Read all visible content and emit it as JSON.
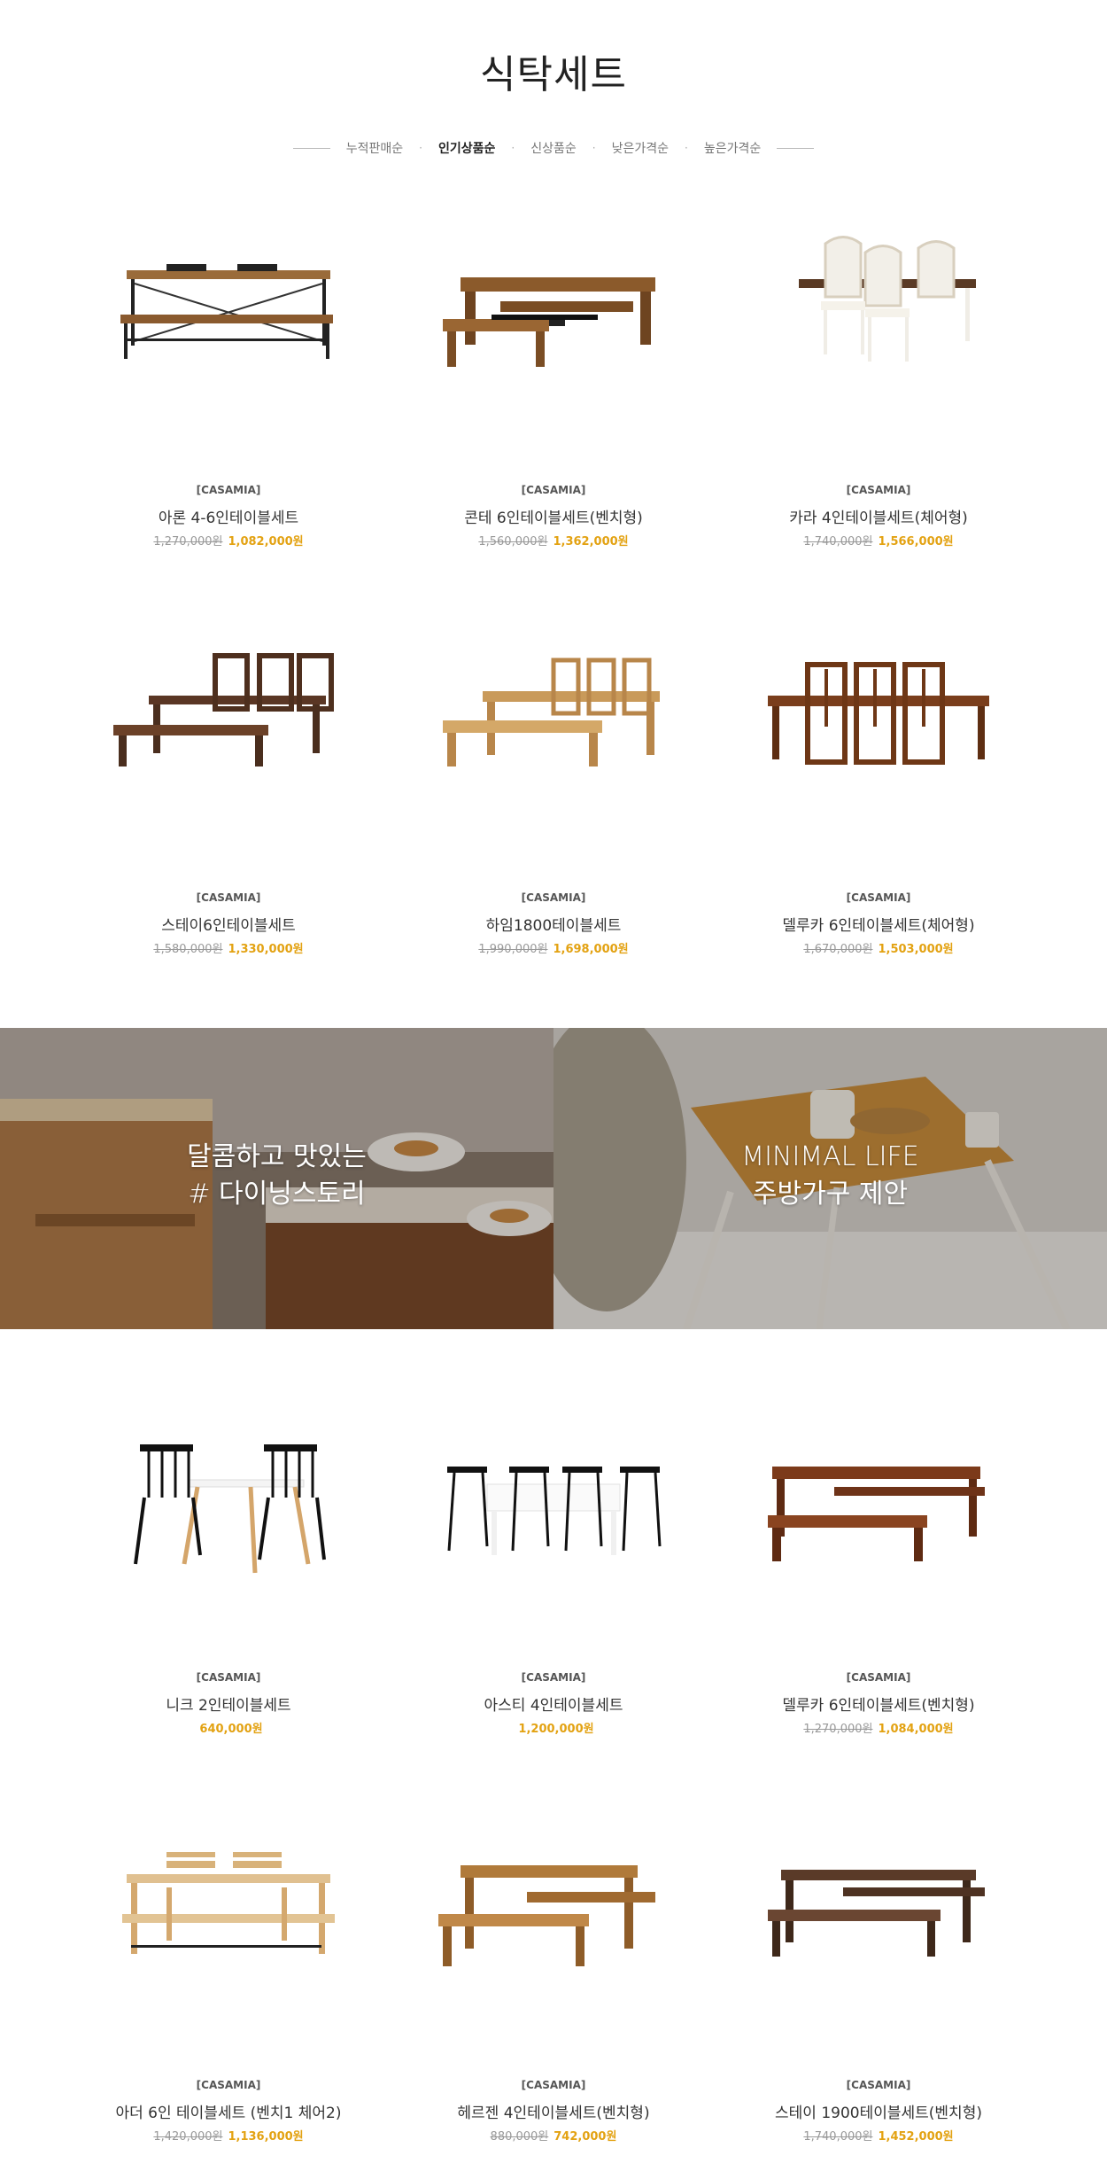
{
  "page": {
    "title": "식탁세트"
  },
  "sort": {
    "options": [
      "누적판매순",
      "인기상품순",
      "신상품순",
      "낮은가격순",
      "높은가격순"
    ],
    "active": "인기상품순"
  },
  "products": [
    {
      "brand": "[CASAMIA]",
      "name": "아론 4-6인테이블세트",
      "old_price": "1,270,000원",
      "price": "1,082,000원",
      "image": "dining-set-bench-black-frame"
    },
    {
      "brand": "[CASAMIA]",
      "name": "콘테 6인테이블세트(벤치형)",
      "old_price": "1,560,000원",
      "price": "1,362,000원",
      "image": "dining-set-wood-benches"
    },
    {
      "brand": "[CASAMIA]",
      "name": "카라 4인테이블세트(체어형)",
      "old_price": "1,740,000원",
      "price": "1,566,000원",
      "image": "dining-set-white-classic-chairs"
    },
    {
      "brand": "[CASAMIA]",
      "name": "스테이6인테이블세트",
      "old_price": "1,580,000원",
      "price": "1,330,000원",
      "image": "dining-set-walnut-chairs-bench"
    },
    {
      "brand": "[CASAMIA]",
      "name": "하임1800테이블세트",
      "old_price": "1,990,000원",
      "price": "1,698,000원",
      "image": "dining-set-oak-chairs-bench"
    },
    {
      "brand": "[CASAMIA]",
      "name": "델루카 6인테이블세트(체어형)",
      "old_price": "1,670,000원",
      "price": "1,503,000원",
      "image": "dining-set-brown-six-chairs"
    },
    {
      "brand": "[CASAMIA]",
      "name": "니크 2인테이블세트",
      "old_price": "",
      "price": "640,000원",
      "image": "dining-set-black-windsor-two"
    },
    {
      "brand": "[CASAMIA]",
      "name": "아스티 4인테이블세트",
      "old_price": "",
      "price": "1,200,000원",
      "image": "dining-set-white-table-black-chairs"
    },
    {
      "brand": "[CASAMIA]",
      "name": "델루카 6인테이블세트(벤치형)",
      "old_price": "1,270,000원",
      "price": "1,084,000원",
      "image": "dining-set-red-brown-benches"
    },
    {
      "brand": "[CASAMIA]",
      "name": "아더 6인 테이블세트 (벤치1 체어2)",
      "old_price": "1,420,000원",
      "price": "1,136,000원",
      "image": "dining-set-light-wood-bench-chairs"
    },
    {
      "brand": "[CASAMIA]",
      "name": "헤르젠 4인테이블세트(벤치형)",
      "old_price": "880,000원",
      "price": "742,000원",
      "image": "dining-set-honey-wood-benches"
    },
    {
      "brand": "[CASAMIA]",
      "name": "스테이 1900테이블세트(벤치형)",
      "old_price": "1,740,000원",
      "price": "1,452,000원",
      "image": "dining-set-dark-walnut-benches"
    }
  ],
  "banners": [
    {
      "line1": "달콤하고 맛있는",
      "line2": "# 다이닝스토리",
      "image": "dining-table-croissant-photo"
    },
    {
      "line1": "MINIMAL LIFE",
      "line2": "주방가구 제안",
      "image": "wood-side-table-cups-photo"
    }
  ],
  "colors": {
    "sale": "#e3a212",
    "old": "#999999",
    "title": "#222222"
  }
}
